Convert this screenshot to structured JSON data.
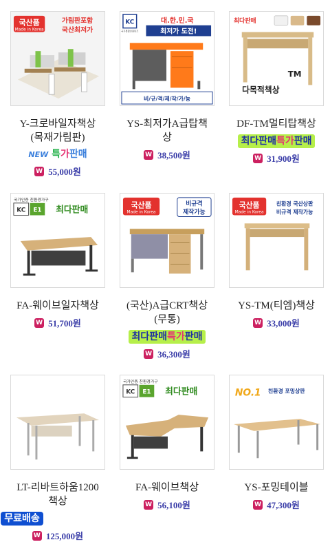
{
  "colors": {
    "price": "#3a3da8",
    "wonIcon": "#cc2060",
    "rankBadgeBg": "#b6ef4a",
    "shipBadgeBg": "#0f4fd1"
  },
  "won_icon_letter": "W",
  "products": [
    {
      "name": "Y-크로바일자책상\n(목재가림판)",
      "badge": {
        "type": "new",
        "n": "NEW",
        "t1": "특",
        "t2": "가",
        "t3": "판매"
      },
      "price": "55,000원",
      "thumb": {
        "tag1": "국산품",
        "tag1sub": "Made in Korea",
        "tag2": "가림판포함",
        "tag3": "국산최저가"
      }
    },
    {
      "name": "YS-최저가A급탑책\n상",
      "badge": null,
      "price": "38,500원",
      "thumb": {
        "top1": "대.한.민.국",
        "top2": "최저가 도전!",
        "bottom": "비/규/격/제/작/가/능",
        "kc": "KC",
        "kcsub": "국가통합인증마크"
      }
    },
    {
      "name": "DF-TM멀티탑책상",
      "badge": {
        "type": "rank",
        "a": "최다판매",
        "b": "특가",
        "c": "판매"
      },
      "price": "31,900원",
      "thumb": {
        "tag1": "최다판매",
        "tm": "TM",
        "sub": "다목적책상"
      }
    },
    {
      "name": "FA-웨이브일자책상",
      "badge": null,
      "price": "51,700원",
      "thumb": {
        "top": "국가인증 친환경가구",
        "kc": "KC",
        "e1": "E1",
        "best": "최다판매"
      }
    },
    {
      "name": "(국산)A급CRT책상\n(무통)",
      "badge": {
        "type": "rank",
        "a": "최다판매",
        "b": "특가",
        "c": "판매"
      },
      "price": "36,300원",
      "thumb": {
        "tag1": "국산품",
        "tag1sub": "Made in Korea",
        "tag2": "비규격",
        "tag3": "제작가능"
      }
    },
    {
      "name": "YS-TM(티엠)책상",
      "badge": null,
      "price": "33,000원",
      "thumb": {
        "tag1": "국산품",
        "tag1sub": "Made in Korea",
        "tag2": "친환경 국산상판",
        "tag3": "비규격 제작가능"
      }
    },
    {
      "name": "LT-리바트하움1200\n책상",
      "badge": {
        "type": "ship",
        "a": "무료배송"
      },
      "price": "125,000원",
      "thumb": {}
    },
    {
      "name": "FA-웨이브책상",
      "badge": null,
      "price": "56,100원",
      "thumb": {
        "top": "국가인증 친환경가구",
        "kc": "KC",
        "e1": "E1",
        "best": "최다판매"
      }
    },
    {
      "name": "YS-포밍테이블",
      "badge": null,
      "price": "47,300원",
      "thumb": {
        "no1": "NO.1",
        "txt": "친환경 포밍상판"
      }
    }
  ]
}
